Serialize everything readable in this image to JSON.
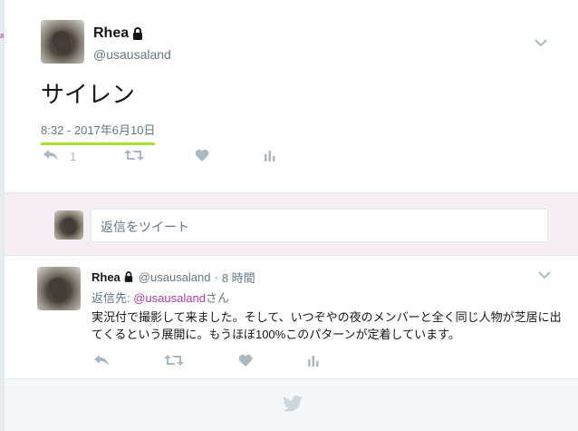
{
  "left_mark": "a",
  "main_tweet": {
    "name": "Rhea",
    "handle": "@usausaland",
    "text": "サイレン",
    "timestamp": "8:32 - 2017年6月10日",
    "reply_count": "1",
    "icons": {
      "lock": "lock-icon",
      "caret": "chevron-down-icon",
      "reply": "reply-icon",
      "retweet": "retweet-icon",
      "like": "heart-icon",
      "analytics": "analytics-icon"
    }
  },
  "reply_composer": {
    "placeholder": "返信をツイート"
  },
  "reply_tweet": {
    "name": "Rhea",
    "handle": "@usausaland",
    "separator": "·",
    "time": "8 時間",
    "replying_to_prefix": "返信先: ",
    "replying_to_handle": "@usausaland",
    "replying_to_suffix": "さん",
    "text": "実況付で撮影して来ました。そして、いつぞやの夜のメンバーと全く同じ人物が芝居に出てくるという展開に。もうほぼ100%このパターンが定着しています。"
  },
  "footer": {
    "icon": "twitter-bird-icon"
  },
  "colors": {
    "accent_underline": "#a6e22e",
    "link": "#b03ca3",
    "reply_box_bg": "#f6eef5",
    "icon_gray": "#aab8c2"
  }
}
